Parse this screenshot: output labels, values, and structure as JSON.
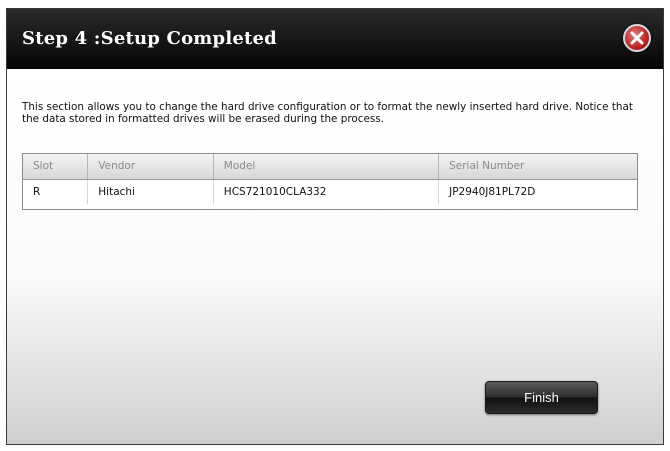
{
  "dialog": {
    "title": "Step 4 :Setup Completed",
    "close_icon": "close-x-icon",
    "description": "This section allows you to change the hard drive configuration or to format the newly inserted hard drive. Notice that the data stored in formatted drives will be erased during the process."
  },
  "table": {
    "headers": [
      "Slot",
      "Vendor",
      "Model",
      "Serial Number"
    ],
    "rows": [
      [
        "R",
        "Hitachi",
        "HCS721010CLA332",
        "JP2940J81PL72D"
      ]
    ]
  },
  "actions": {
    "finish_label": "Finish"
  },
  "colors": {
    "titlebar": "#0a0a0a",
    "close_button": "#c0392b",
    "button": "#2c2c2c"
  }
}
